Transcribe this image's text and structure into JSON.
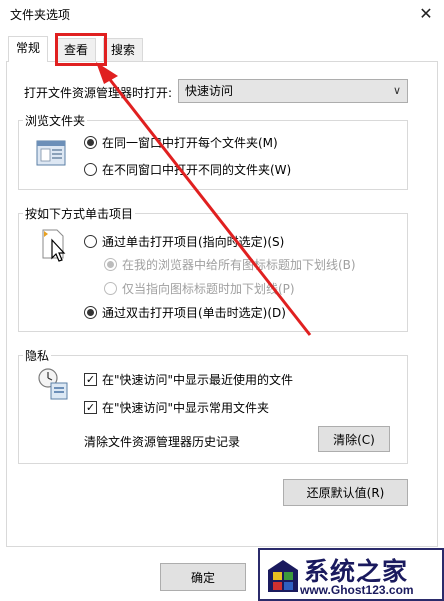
{
  "window": {
    "title": "文件夹选项",
    "close_glyph": "✕"
  },
  "tabs": [
    {
      "label": "常规"
    },
    {
      "label": "查看"
    },
    {
      "label": "搜索"
    }
  ],
  "general": {
    "open_in_label": "打开文件资源管理器时打开:",
    "open_in_value": "快速访问",
    "browse": {
      "legend": "浏览文件夹",
      "options": [
        {
          "label": "在同一窗口中打开每个文件夹(M)",
          "selected": true
        },
        {
          "label": "在不同窗口中打开不同的文件夹(W)",
          "selected": false
        }
      ]
    },
    "click": {
      "legend": "按如下方式单击项目",
      "single_label": "通过单击打开项目(指向时选定)(S)",
      "underline_all_label": "在我的浏览器中给所有图标标题加下划线(B)",
      "underline_point_label": "仅当指向图标标题时加下划线(P)",
      "double_label": "通过双击打开项目(单击时选定)(D)"
    },
    "privacy": {
      "legend": "隐私",
      "recent_files_label": "在\"快速访问\"中显示最近使用的文件",
      "frequent_folders_label": "在\"快速访问\"中显示常用文件夹",
      "clear_history_label": "清除文件资源管理器历史记录",
      "clear_button": "清除(C)"
    },
    "restore_defaults": "还原默认值(R)"
  },
  "footer": {
    "ok": "确定"
  },
  "watermark": {
    "main": "系统之家",
    "url": "www.Ghost123.com"
  },
  "colors": {
    "annotation": "#e02020",
    "accent": "#1a1a5e"
  },
  "icons": {
    "browse": "folder-window-icon",
    "click": "cursor-click-icon",
    "privacy": "clock-document-icon"
  }
}
